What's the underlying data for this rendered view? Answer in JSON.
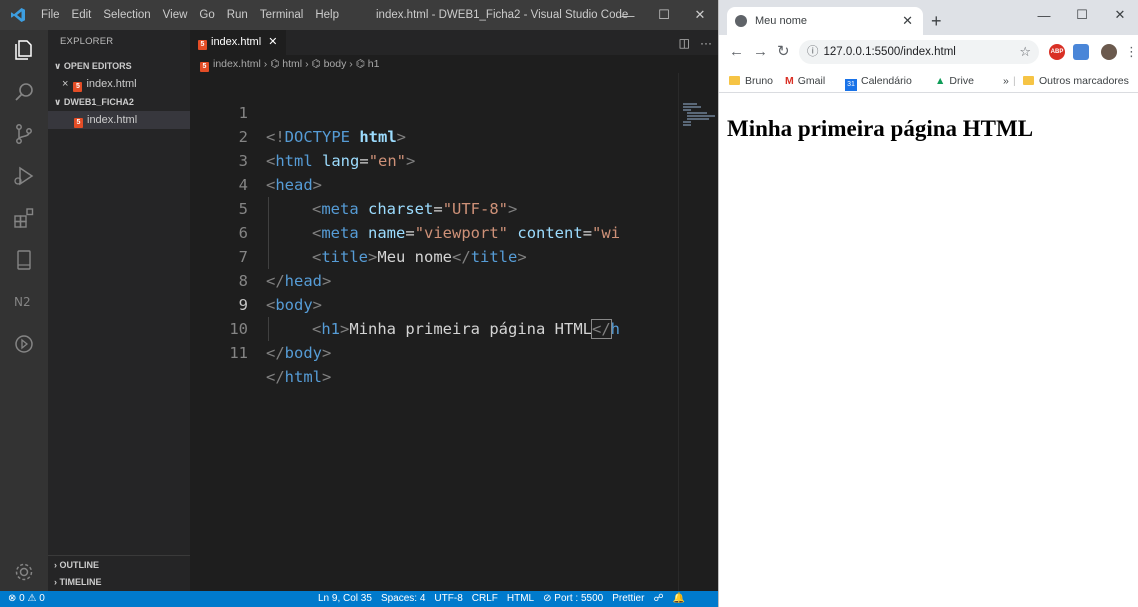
{
  "vscode": {
    "menu": [
      "File",
      "Edit",
      "Selection",
      "View",
      "Go",
      "Run",
      "Terminal",
      "Help"
    ],
    "window_title": "index.html - DWEB1_Ficha2 - Visual Studio Code",
    "sidebar": {
      "title": "EXPLORER",
      "open_editors_label": "OPEN EDITORS",
      "open_editor_file": "index.html",
      "folder_label": "DWEB1_FICHA2",
      "folder_file": "index.html",
      "outline_label": "OUTLINE",
      "timeline_label": "TIMELINE"
    },
    "tab": {
      "label": "index.html"
    },
    "breadcrumb": [
      "index.html",
      "html",
      "body",
      "h1"
    ],
    "line_numbers": [
      "1",
      "2",
      "3",
      "4",
      "5",
      "6",
      "7",
      "8",
      "9",
      "10",
      "11"
    ],
    "code": {
      "l1": {
        "open": "<!",
        "kw": "DOCTYPE",
        "sp": " ",
        "name": "html",
        "close": ">"
      },
      "l2": {
        "open": "<",
        "tag": "html",
        "attr": "lang",
        "eq": "=",
        "val": "\"en\"",
        "close": ">"
      },
      "l3": {
        "open": "<",
        "tag": "head",
        "close": ">"
      },
      "l4": {
        "open": "<",
        "tag": "meta",
        "attr": "charset",
        "eq": "=",
        "val": "\"UTF-8\"",
        "close": ">"
      },
      "l5": {
        "open": "<",
        "tag": "meta",
        "attr": "name",
        "eq": "=",
        "val": "\"viewport\"",
        "attr2": "content",
        "eq2": "=",
        "val2": "\"wi"
      },
      "l6": {
        "open": "<",
        "tag": "title",
        "close": ">",
        "text": "Meu nome",
        "open2": "</",
        "tag2": "title",
        "close2": ">"
      },
      "l7": {
        "open": "</",
        "tag": "head",
        "close": ">"
      },
      "l8": {
        "open": "<",
        "tag": "body",
        "close": ">"
      },
      "l9": {
        "open": "<",
        "tag": "h1",
        "close": ">",
        "text": "Minha primeira página HTML",
        "open2": "</",
        "tag2": "h"
      },
      "l10": {
        "open": "</",
        "tag": "body",
        "close": ">"
      },
      "l11": {
        "open": "</",
        "tag": "html",
        "close": ">"
      }
    },
    "status": {
      "left": "⊗ 0 ⚠ 0",
      "position": "Ln 9, Col 35",
      "spaces": "Spaces: 4",
      "encoding": "UTF-8",
      "eol": "CRLF",
      "language": "HTML",
      "port": "⊘ Port : 5500",
      "formatter": "Prettier"
    }
  },
  "chrome": {
    "tab_title": "Meu nome",
    "url": "127.0.0.1:5500/index.html",
    "bookmarks": [
      "Bruno",
      "Gmail",
      "Calendário",
      "Drive"
    ],
    "bookmarks_overflow": "»",
    "other_bookmarks": "Outros marcadores",
    "ext_abp": "ABP",
    "calendar_day": "31",
    "page": {
      "heading": "Minha primeira página HTML"
    }
  }
}
